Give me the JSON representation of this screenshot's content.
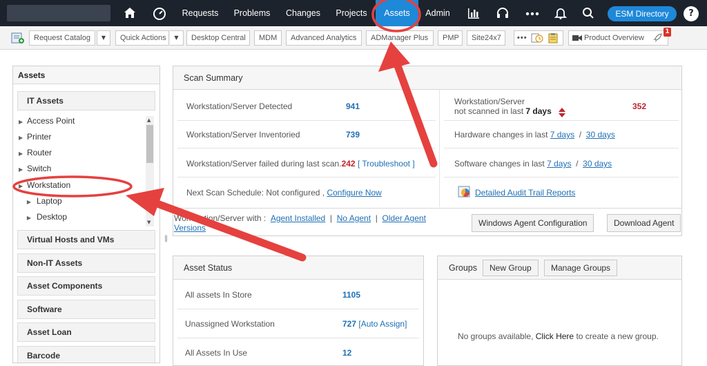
{
  "topnav": {
    "items": [
      {
        "label": "Requests"
      },
      {
        "label": "Problems"
      },
      {
        "label": "Changes"
      },
      {
        "label": "Projects"
      },
      {
        "label": "Assets"
      },
      {
        "label": "Admin"
      }
    ],
    "esm_label": "ESM Directory",
    "help_label": "?"
  },
  "quickbar": {
    "request_catalog": "Request Catalog",
    "quick_actions": "Quick Actions",
    "desktop_central": "Desktop Central",
    "mdm": "MDM",
    "advanced_analytics": "Advanced Analytics",
    "admanager": "ADManager Plus",
    "pmp": "PMP",
    "site24x7": "Site24x7",
    "product_overview": "Product Overview",
    "badge": "1"
  },
  "sidebar": {
    "title": "Assets",
    "it_assets": "IT Assets",
    "tree": [
      "Access Point",
      "Printer",
      "Router",
      "Switch",
      "Workstation",
      "Laptop",
      "Desktop"
    ],
    "categories": [
      "Virtual Hosts and VMs",
      "Non-IT Assets",
      "Asset Components",
      "Software",
      "Asset Loan",
      "Barcode"
    ]
  },
  "scan_summary": {
    "title": "Scan Summary",
    "detected_label": "Workstation/Server Detected",
    "detected_value": "941",
    "inventoried_label": "Workstation/Server Inventoried",
    "inventoried_value": "739",
    "failed_label": "Workstation/Server failed during last scan.",
    "failed_value": "242",
    "troubleshoot": "[ Troubleshoot ]",
    "schedule_label": "Next Scan Schedule: Not configured ,",
    "configure_now": "Configure Now",
    "not_scanned_line1": "Workstation/Server",
    "not_scanned_line2": "not scanned in last",
    "not_scanned_days": "7 days",
    "not_scanned_value": "352",
    "hardware_label": "Hardware changes in last",
    "software_label": "Software changes in last",
    "seven_days": "7 days",
    "thirty_days": "30 days",
    "sep": "/",
    "audit_link": "Detailed Audit Trail Reports",
    "with_label": "Workstation/Server with :",
    "agent_installed": "Agent Installed",
    "no_agent": "No Agent",
    "older_agent_1": "Older Agent",
    "older_agent_2": "Versions",
    "pipe": "|",
    "win_agent_config": "Windows Agent Configuration",
    "download_agent": "Download Agent"
  },
  "asset_status": {
    "title": "Asset Status",
    "in_store_label": "All assets In Store",
    "in_store_value": "1105",
    "unassigned_label": "Unassigned Workstation",
    "unassigned_value": "727",
    "auto_assign": "[Auto Assign]",
    "in_use_label": "All Assets In Use",
    "in_use_value": "12"
  },
  "groups": {
    "title": "Groups",
    "new_group": "New Group",
    "manage_groups": "Manage Groups",
    "empty_prefix": "No groups available,",
    "click_here": "Click Here",
    "empty_suffix": "to create a new group."
  },
  "colors": {
    "topbar": "#1d232c",
    "accent": "#1e88d9",
    "link": "#1f6fb5",
    "annotation": "#e5413f"
  }
}
